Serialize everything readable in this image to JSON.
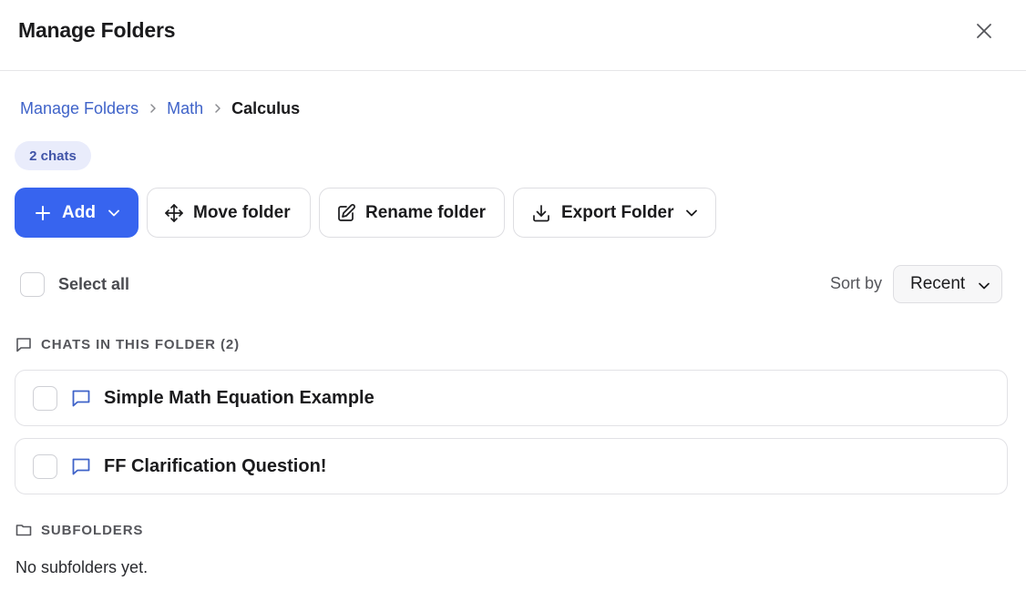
{
  "dialog": {
    "title": "Manage Folders",
    "close_icon": "close-icon"
  },
  "breadcrumb": {
    "items": [
      "Manage Folders",
      "Math"
    ],
    "current": "Calculus"
  },
  "badge": {
    "label": "2 chats"
  },
  "toolbar": {
    "add_label": "Add",
    "move_label": "Move folder",
    "rename_label": "Rename folder",
    "export_label": "Export Folder"
  },
  "selection": {
    "select_all_label": "Select all"
  },
  "sort": {
    "label": "Sort by",
    "value": "Recent"
  },
  "chats_section": {
    "heading": "CHATS IN THIS FOLDER (2)",
    "items": [
      {
        "title": "Simple Math Equation Example"
      },
      {
        "title": "FF Clarification Question!"
      }
    ]
  },
  "subfolders_section": {
    "heading": "SUBFOLDERS",
    "empty_text": "No subfolders yet."
  },
  "colors": {
    "accent": "#3764ef",
    "link": "#3f63c9",
    "badge_bg": "#e9ecfb",
    "badge_text": "#4054a8"
  }
}
